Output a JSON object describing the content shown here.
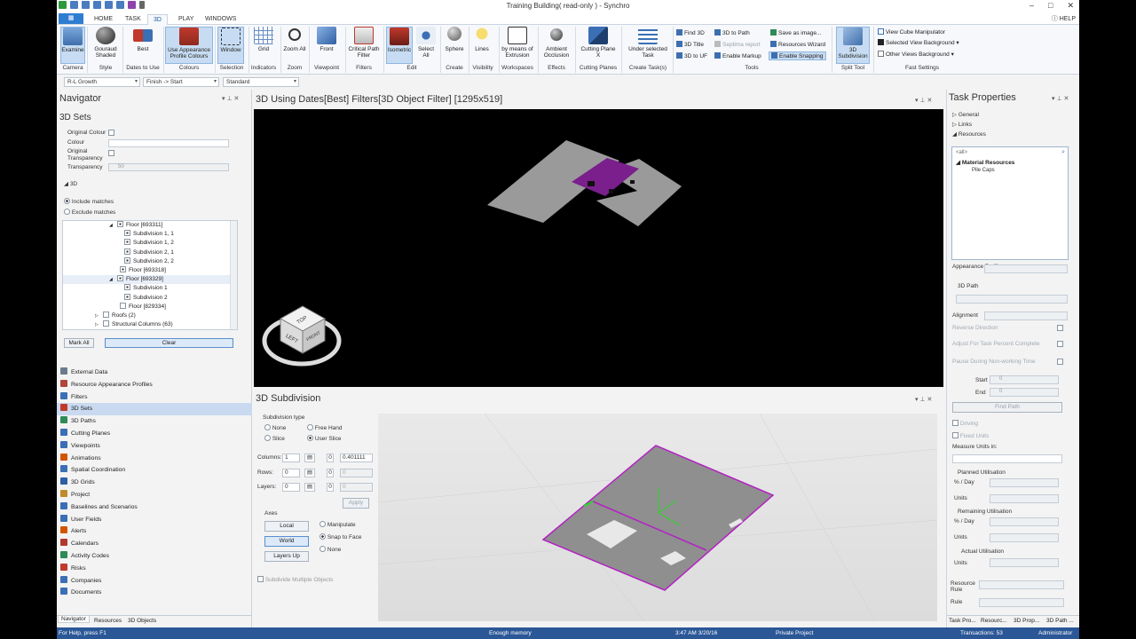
{
  "window": {
    "title": "Training Building( read-only ) - Synchro",
    "minimize": "–",
    "restore": "□",
    "close": "✕"
  },
  "tabs": [
    "HOME",
    "TASK",
    "3D",
    "PLAY",
    "WINDOWS"
  ],
  "help": "HELP",
  "ribbon": {
    "examine": "Examine",
    "camera_group": "Camera",
    "gouraud": "Gouraud Shaded",
    "style_group": "Style",
    "best": "Best",
    "dates_group": "Dates to Use",
    "use_appearance": "Use Appearance Profile Colours",
    "colours_group": "Colours",
    "window": "Window",
    "selection_group": "Selection",
    "grid": "Grid",
    "indicators_group": "Indicators",
    "zoom_all": "Zoom All",
    "zoom_group": "Zoom",
    "front": "Front",
    "viewpoint_group": "Viewpoint",
    "critical": "Critical Path Filter",
    "filters_group": "Filters",
    "isometric": "Isometric",
    "select_all": "Select All",
    "edit_group": "Edit",
    "sphere": "Sphere",
    "create_group": "Create",
    "lines": "Lines",
    "visibility_group": "Visibility",
    "by_extrusion": "by means of Extrusion",
    "workspaces_group": "Workspaces",
    "ambient": "Ambient Occlusion",
    "effects_group": "Effects",
    "cutting": "Cutting Plane X",
    "cutting_group": "Cutting Planes",
    "under_task": "Under selected Task",
    "create_tasks_group": "Create Task(s)",
    "find_3d": "Find 3D",
    "path_3d": "3D to Path",
    "save_image": "Save as image...",
    "title_3d": "3D Title",
    "septima": "Septima report",
    "res_wizard": "Resources Wizard",
    "to_uf": "3D to UF",
    "enable_markup": "Enable Markup",
    "enable_snapping": "Enable Snapping",
    "tools_group": "Tools",
    "subdivision": "3D Subdivision",
    "split_group": "Split Tool",
    "view_cube": "View Cube Manipulator",
    "sel_bg": "Selected View Background",
    "other_bg": "Other Views Background",
    "fast_group": "Fast Settings"
  },
  "filterbar": {
    "profile": "R-L Growth",
    "dates": "Finish -> Start",
    "mode": "Standard"
  },
  "navigator": {
    "title": "Navigator",
    "subtitle": "3D Sets",
    "orig_colour": "Original Colour",
    "colour": "Colour",
    "orig_transp": "Original Transparency",
    "transparency": "Transparency",
    "transp_value": "50",
    "section_3d": "3D",
    "include": "Include matches",
    "exclude": "Exclude matches",
    "tree": [
      {
        "indent": 56,
        "label": "Floor [693311]",
        "exp": "◢",
        "checked": true,
        "sel": false
      },
      {
        "indent": 72,
        "label": "Subdivision 1, 1",
        "exp": "",
        "checked": true,
        "sel": false
      },
      {
        "indent": 72,
        "label": "Subdivision 1, 2",
        "exp": "",
        "checked": true,
        "sel": false
      },
      {
        "indent": 72,
        "label": "Subdivision 2, 1",
        "exp": "",
        "checked": true,
        "sel": false
      },
      {
        "indent": 72,
        "label": "Subdivision 2, 2",
        "exp": "",
        "checked": true,
        "sel": false
      },
      {
        "indent": 62,
        "label": "Floor [693318]",
        "exp": "",
        "checked": true,
        "sel": false
      },
      {
        "indent": 56,
        "label": "Floor [693329]",
        "exp": "◢",
        "checked": true,
        "sel": true
      },
      {
        "indent": 72,
        "label": "Subdivision 1",
        "exp": "",
        "checked": true,
        "sel": false
      },
      {
        "indent": 72,
        "label": "Subdivision 2",
        "exp": "",
        "checked": true,
        "sel": false
      },
      {
        "indent": 62,
        "label": "Floor [829334]",
        "exp": "",
        "checked": false,
        "sel": false
      },
      {
        "indent": 24,
        "label": "Roofs (2)",
        "exp": "▷",
        "checked": false,
        "sel": false
      },
      {
        "indent": 24,
        "label": "Structural Columns (63)",
        "exp": "▷",
        "checked": false,
        "sel": false
      }
    ],
    "mark_all": "Mark All",
    "clear": "Clear",
    "items": [
      {
        "label": "External Data",
        "color": "#6a7b8c",
        "sel": false
      },
      {
        "label": "Resource Appearance Profiles",
        "color": "#b0453a",
        "sel": false
      },
      {
        "label": "Filters",
        "color": "#3b6fb5",
        "sel": false
      },
      {
        "label": "3D Sets",
        "color": "#c0392b",
        "sel": true
      },
      {
        "label": "3D Paths",
        "color": "#2e8b57",
        "sel": false
      },
      {
        "label": "Cutting Planes",
        "color": "#3b6fb5",
        "sel": false
      },
      {
        "label": "Viewpoints",
        "color": "#3b6fb5",
        "sel": false
      },
      {
        "label": "Animations",
        "color": "#d35400",
        "sel": false
      },
      {
        "label": "Spatial Coordination",
        "color": "#3b6fb5",
        "sel": false
      },
      {
        "label": "3D Grids",
        "color": "#2e5fa5",
        "sel": false
      },
      {
        "label": "Project",
        "color": "#c08b2b",
        "sel": false
      },
      {
        "label": "Baselines and Scenarios",
        "color": "#3b6fb5",
        "sel": false
      },
      {
        "label": "User Fields",
        "color": "#3b6fb5",
        "sel": false
      },
      {
        "label": "Alerts",
        "color": "#d35400",
        "sel": false
      },
      {
        "label": "Calendars",
        "color": "#b03a2e",
        "sel": false
      },
      {
        "label": "Activity Codes",
        "color": "#2e8b57",
        "sel": false
      },
      {
        "label": "Risks",
        "color": "#c0392b",
        "sel": false
      },
      {
        "label": "Companies",
        "color": "#3b6fb5",
        "sel": false
      },
      {
        "label": "Documents",
        "color": "#3b6fb5",
        "sel": false
      }
    ],
    "tabs": [
      "Navigator",
      "Resources",
      "3D Objects"
    ]
  },
  "view3d": {
    "title": "3D Using Dates[Best] Filters[3D Object Filter] [1295x519]",
    "cube_top": "TOP",
    "cube_left": "LEFT",
    "cube_front": "FRONT"
  },
  "subdivision": {
    "title": "3D Subdivision",
    "type_label": "Subdivision type",
    "none": "None",
    "free_hand": "Free Hand",
    "slice": "Slice",
    "user_slice": "User Slice",
    "columns": "Columns:",
    "columns_val": "1",
    "columns_width": "0.401111",
    "rows": "Rows:",
    "rows_val": "0",
    "layers": "Layers:",
    "layers_val": "0",
    "zero": "0",
    "apply": "Apply",
    "axes": "Axes",
    "local": "Local",
    "world": "World",
    "layers_up": "Layers Up",
    "manipulate": "Manipulate",
    "snap_face": "Snap to Face",
    "none2": "None",
    "multi": "Subdivide Multiple Objects"
  },
  "taskprops": {
    "title": "Task Properties",
    "general": "General",
    "links": "Links",
    "resources": "Resources",
    "all": "<all>",
    "mat_res": "Material Resources",
    "pile_caps": "Pile Caps",
    "appearance_profile": "Appearance Profile",
    "path_3d": "3D Path",
    "alignment": "Alignment",
    "reverse": "Reverse Direction",
    "adjust": "Adjust For Task Percent Complete",
    "pause": "Pause During Non-working Time",
    "start": "Start",
    "end": "End",
    "zero": "0",
    "find_path": "Find Path",
    "driving": "Driving",
    "fixed_units": "Fixed Units",
    "measure": "Measure Units in:",
    "planned": "Planned Utilisation",
    "pct_day": "% / Day",
    "units": "Units",
    "remaining": "Remaining Utilisation",
    "actual": "Actual Utilisation",
    "resource_rule": "Resource Rule",
    "rule": "Rule",
    "tabs": [
      "Task Pro...",
      "Resourc...",
      "3D Prop...",
      "3D Path ..."
    ]
  },
  "status": {
    "help": "For Help, press F1",
    "memory": "Enough memory",
    "hidden": "",
    "time": "3:47 AM 3/20/16",
    "project": "Private Project",
    "transactions": "Transactions: 53",
    "user": "Administrator"
  }
}
